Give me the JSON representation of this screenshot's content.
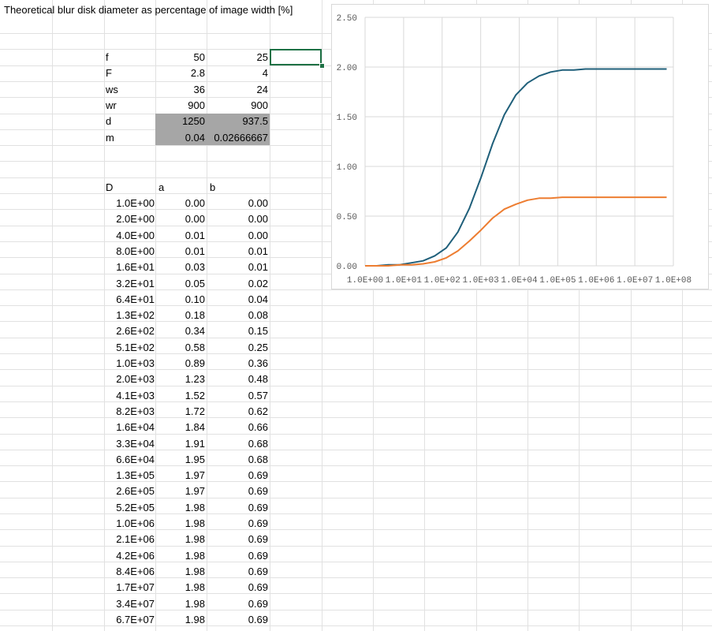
{
  "sheet": {
    "title": "Theoretical blur disk diameter as percentage of image width [%]",
    "params": [
      {
        "label": "f",
        "v1": "50",
        "v2": "25"
      },
      {
        "label": "F",
        "v1": "2.8",
        "v2": "4"
      },
      {
        "label": "ws",
        "v1": "36",
        "v2": "24"
      },
      {
        "label": "wr",
        "v1": "900",
        "v2": "900"
      },
      {
        "label": "d",
        "v1": "1250",
        "v2": "937.5"
      },
      {
        "label": "m",
        "v1": "0.04",
        "v2": "0.02666667"
      }
    ],
    "headers": {
      "D": "D",
      "a": "a",
      "b": "b"
    },
    "rows": [
      [
        "1.0E+00",
        "0.00",
        "0.00"
      ],
      [
        "2.0E+00",
        "0.00",
        "0.00"
      ],
      [
        "4.0E+00",
        "0.01",
        "0.00"
      ],
      [
        "8.0E+00",
        "0.01",
        "0.01"
      ],
      [
        "1.6E+01",
        "0.03",
        "0.01"
      ],
      [
        "3.2E+01",
        "0.05",
        "0.02"
      ],
      [
        "6.4E+01",
        "0.10",
        "0.04"
      ],
      [
        "1.3E+02",
        "0.18",
        "0.08"
      ],
      [
        "2.6E+02",
        "0.34",
        "0.15"
      ],
      [
        "5.1E+02",
        "0.58",
        "0.25"
      ],
      [
        "1.0E+03",
        "0.89",
        "0.36"
      ],
      [
        "2.0E+03",
        "1.23",
        "0.48"
      ],
      [
        "4.1E+03",
        "1.52",
        "0.57"
      ],
      [
        "8.2E+03",
        "1.72",
        "0.62"
      ],
      [
        "1.6E+04",
        "1.84",
        "0.66"
      ],
      [
        "3.3E+04",
        "1.91",
        "0.68"
      ],
      [
        "6.6E+04",
        "1.95",
        "0.68"
      ],
      [
        "1.3E+05",
        "1.97",
        "0.69"
      ],
      [
        "2.6E+05",
        "1.97",
        "0.69"
      ],
      [
        "5.2E+05",
        "1.98",
        "0.69"
      ],
      [
        "1.0E+06",
        "1.98",
        "0.69"
      ],
      [
        "2.1E+06",
        "1.98",
        "0.69"
      ],
      [
        "4.2E+06",
        "1.98",
        "0.69"
      ],
      [
        "8.4E+06",
        "1.98",
        "0.69"
      ],
      [
        "1.7E+07",
        "1.98",
        "0.69"
      ],
      [
        "3.4E+07",
        "1.98",
        "0.69"
      ],
      [
        "6.7E+07",
        "1.98",
        "0.69"
      ]
    ]
  },
  "colors": {
    "series_a": "#1f5f7a",
    "series_b": "#ed7d31",
    "gridline": "#d9d9d9",
    "shade": "#a6a6a6",
    "selection": "#1e7145"
  },
  "chart_data": {
    "type": "line",
    "title": "",
    "xlabel": "",
    "ylabel": "",
    "x_scale": "log",
    "x": [
      1,
      2,
      4,
      8,
      16,
      32,
      64,
      128,
      256,
      512,
      1024,
      2048,
      4096,
      8192,
      16384,
      32768,
      65536,
      131072,
      262144,
      524288,
      1048576,
      2097152,
      4194304,
      8388608,
      16777216,
      33554432,
      67108864
    ],
    "series": [
      {
        "values": [
          0.0,
          0.0,
          0.01,
          0.01,
          0.03,
          0.05,
          0.1,
          0.18,
          0.34,
          0.58,
          0.89,
          1.23,
          1.52,
          1.72,
          1.84,
          1.91,
          1.95,
          1.97,
          1.97,
          1.98,
          1.98,
          1.98,
          1.98,
          1.98,
          1.98,
          1.98,
          1.98
        ]
      },
      {
        "values": [
          0.0,
          0.0,
          0.0,
          0.01,
          0.01,
          0.02,
          0.04,
          0.08,
          0.15,
          0.25,
          0.36,
          0.48,
          0.57,
          0.62,
          0.66,
          0.68,
          0.68,
          0.69,
          0.69,
          0.69,
          0.69,
          0.69,
          0.69,
          0.69,
          0.69,
          0.69,
          0.69
        ]
      }
    ],
    "ylim": [
      0,
      2.5
    ],
    "yticks": [
      "0.00",
      "0.50",
      "1.00",
      "1.50",
      "2.00",
      "2.50"
    ],
    "xlim": [
      1,
      100000000
    ],
    "xticks": [
      "1.0E+00",
      "1.0E+01",
      "1.0E+02",
      "1.0E+03",
      "1.0E+04",
      "1.0E+05",
      "1.0E+06",
      "1.0E+07",
      "1.0E+08"
    ],
    "grid": true,
    "legend": "none"
  }
}
